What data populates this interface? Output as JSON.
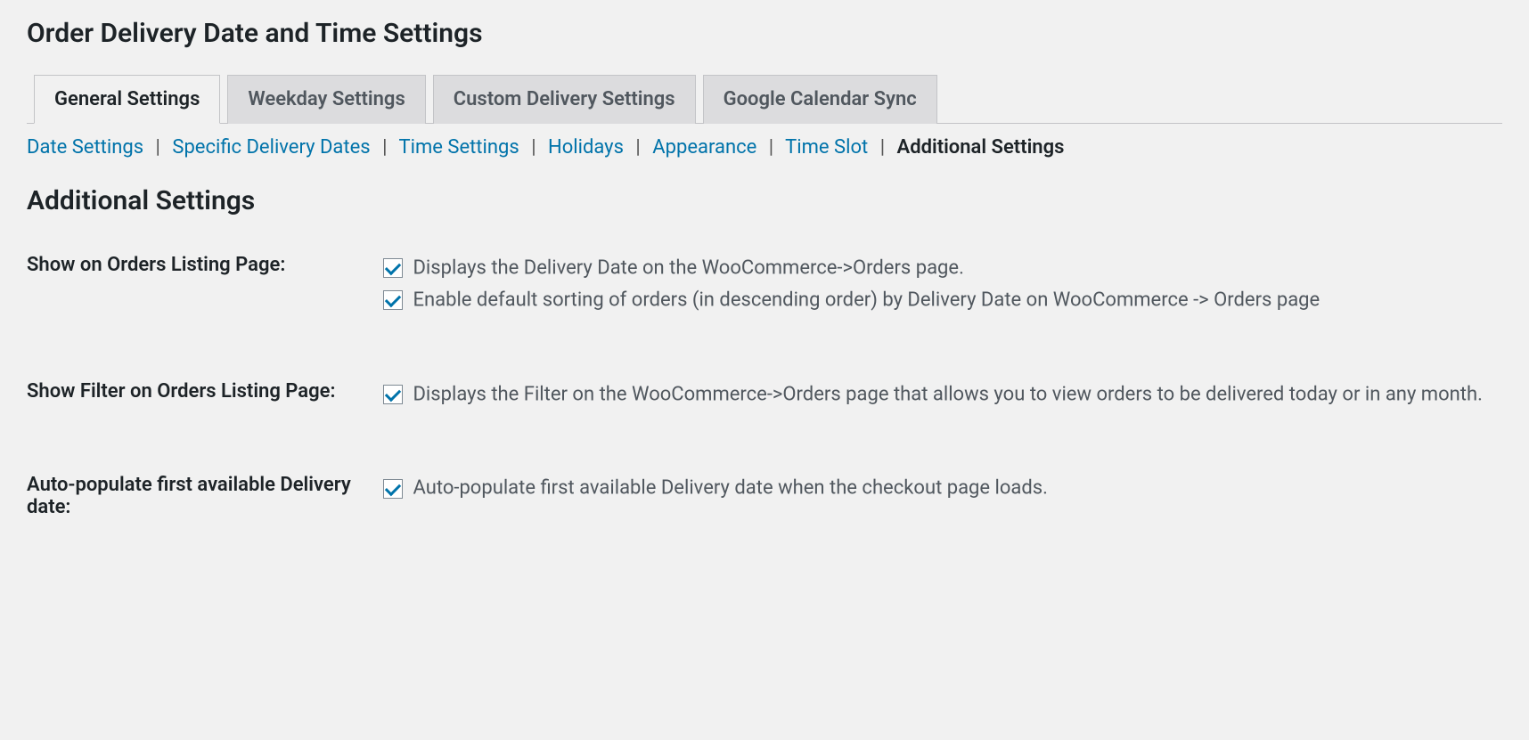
{
  "page": {
    "title": "Order Delivery Date and Time Settings"
  },
  "tabs": {
    "general": "General Settings",
    "weekday": "Weekday Settings",
    "custom": "Custom Delivery Settings",
    "google": "Google Calendar Sync"
  },
  "subnav": {
    "date_settings": "Date Settings",
    "specific_delivery_dates": "Specific Delivery Dates",
    "time_settings": "Time Settings",
    "holidays": "Holidays",
    "appearance": "Appearance",
    "time_slot": "Time Slot",
    "additional_settings": "Additional Settings"
  },
  "section": {
    "title": "Additional Settings"
  },
  "fields": {
    "show_on_orders": {
      "label": "Show on Orders Listing Page:",
      "option1_desc": "Displays the Delivery Date on the WooCommerce->Orders page.",
      "option1_checked": true,
      "option2_desc": "Enable default sorting of orders (in descending order) by Delivery Date on WooCommerce -> Orders page",
      "option2_checked": true
    },
    "show_filter": {
      "label": "Show Filter on Orders Listing Page:",
      "option1_desc": "Displays the Filter on the WooCommerce->Orders page that allows you to view orders to be delivered today or in any month.",
      "option1_checked": true
    },
    "auto_populate": {
      "label": "Auto-populate first available Delivery date:",
      "option1_desc": "Auto-populate first available Delivery date when the checkout page loads.",
      "option1_checked": true
    }
  }
}
